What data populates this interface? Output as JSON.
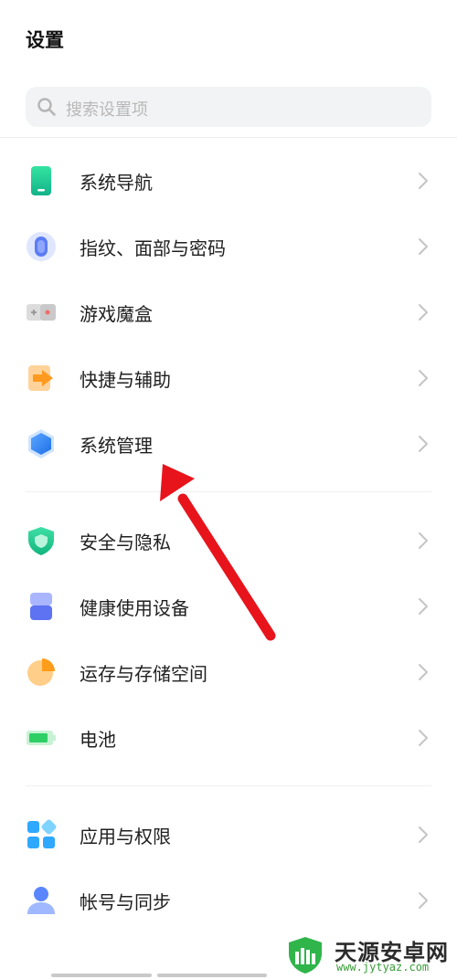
{
  "header": {
    "title": "设置"
  },
  "search": {
    "placeholder": "搜索设置项"
  },
  "groups": [
    {
      "items": [
        {
          "label": "系统导航",
          "icon": "phone-navigation-icon"
        },
        {
          "label": "指纹、面部与密码",
          "icon": "fingerprint-icon"
        },
        {
          "label": "游戏魔盒",
          "icon": "game-box-icon"
        },
        {
          "label": "快捷与辅助",
          "icon": "shortcut-arrow-icon"
        },
        {
          "label": "系统管理",
          "icon": "hexagon-system-icon"
        }
      ]
    },
    {
      "items": [
        {
          "label": "安全与隐私",
          "icon": "shield-icon"
        },
        {
          "label": "健康使用设备",
          "icon": "hourglass-icon"
        },
        {
          "label": "运存与存储空间",
          "icon": "storage-pie-icon"
        },
        {
          "label": "电池",
          "icon": "battery-icon"
        }
      ]
    },
    {
      "items": [
        {
          "label": "应用与权限",
          "icon": "apps-grid-icon"
        },
        {
          "label": "帐号与同步",
          "icon": "account-person-icon"
        }
      ]
    }
  ],
  "watermark": {
    "text": "天源安卓网",
    "url": "www.jytyaz.com"
  },
  "colors": {
    "accent": "#3a7bff",
    "arrow": "#e8141c",
    "chevron": "#c4c4c4"
  }
}
